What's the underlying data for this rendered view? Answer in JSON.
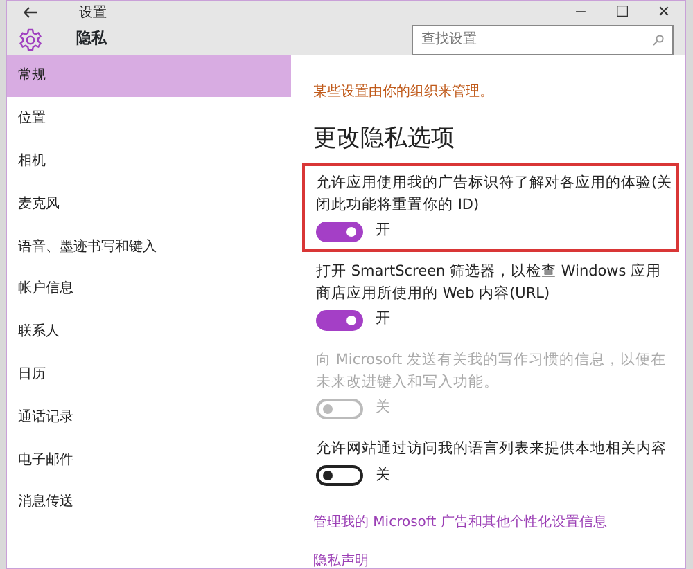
{
  "window": {
    "title": "设置",
    "controls": [
      "−",
      "☐",
      "✕"
    ]
  },
  "header": {
    "title": "隐私",
    "search": {
      "placeholder": "查找设置"
    }
  },
  "sidebar": {
    "items": [
      {
        "label": "常规",
        "selected": true
      },
      {
        "label": "位置",
        "selected": false
      },
      {
        "label": "相机",
        "selected": false
      },
      {
        "label": "麦克风",
        "selected": false
      },
      {
        "label": "语音、墨迹书写和键入",
        "selected": false
      },
      {
        "label": "帐户信息",
        "selected": false
      },
      {
        "label": "联系人",
        "selected": false
      },
      {
        "label": "日历",
        "selected": false
      },
      {
        "label": "通话记录",
        "selected": false
      },
      {
        "label": "电子邮件",
        "selected": false
      },
      {
        "label": "消息传送",
        "selected": false
      }
    ]
  },
  "content": {
    "notice": "某些设置由你的组织来管理。",
    "heading": "更改隐私选项",
    "options": [
      {
        "text": "允许应用使用我的广告标识符了解对各应用的体验(关闭此功能将重置你的 ID)",
        "on": true,
        "disabled": false,
        "state_label": "开",
        "highlighted": true
      },
      {
        "text": "打开 SmartScreen 筛选器，以检查 Windows 应用商店应用所使用的 Web 内容(URL)",
        "on": true,
        "disabled": false,
        "state_label": "开",
        "highlighted": false
      },
      {
        "text": "向 Microsoft 发送有关我的写作习惯的信息，以便在未来改进键入和写入功能。",
        "on": false,
        "disabled": true,
        "state_label": "关",
        "highlighted": false
      },
      {
        "text": "允许网站通过访问我的语言列表来提供本地相关内容",
        "on": false,
        "disabled": false,
        "state_label": "关",
        "highlighted": false
      }
    ],
    "links": [
      "管理我的 Microsoft 广告和其他个性化设置信息",
      "隐私声明"
    ]
  }
}
